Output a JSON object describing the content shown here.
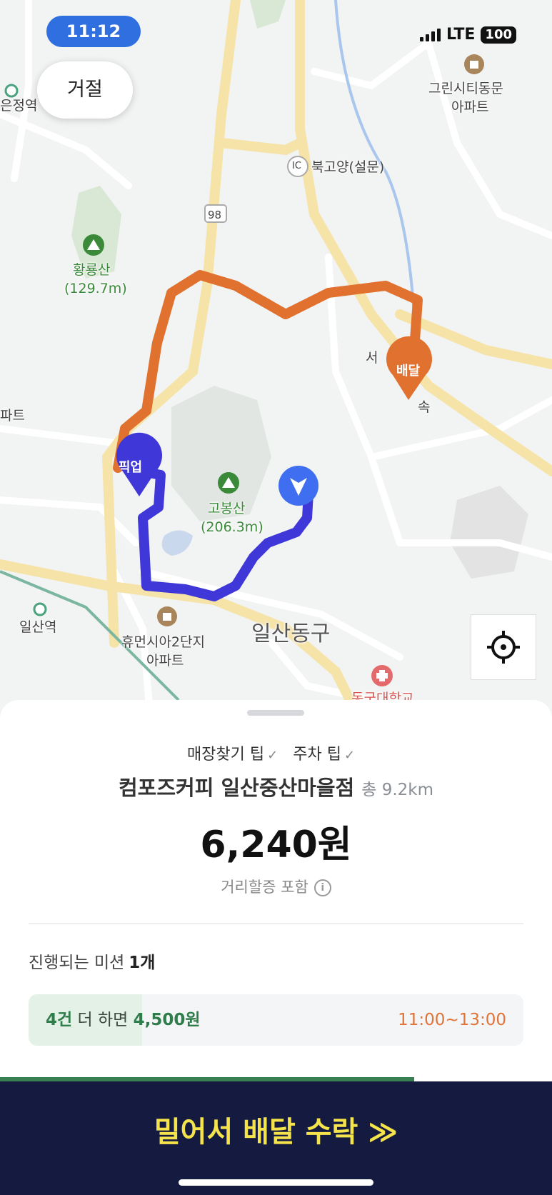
{
  "status_bar": {
    "time": "11:12",
    "network": "LTE",
    "battery": "100"
  },
  "map": {
    "reject_button": "거절",
    "markers": {
      "pickup": "픽업",
      "delivery": "배달"
    },
    "labels": {
      "station_top": "은정역",
      "green_city_1": "그린시티동문",
      "green_city_2": "아파트",
      "ic_badge": "IC",
      "bukgoyang": "북고양(설문)",
      "route_98": "98",
      "hwangyongsan_1": "황룡산",
      "hwangyongsan_2": "(129.7m)",
      "apt_left": "파트",
      "gobongsan_1": "고봉산",
      "gobongsan_2": "(206.3m)",
      "ilsan_station": "일산역",
      "humensia_1": "휴먼시아2단지",
      "humensia_2": "아파트",
      "district": "일산동구",
      "expressway_a": "서",
      "expressway_b": "속",
      "hospital": "동국대학교"
    },
    "route_colors": {
      "pickup_route": "#3f37d8",
      "delivery_route": "#e0712f"
    }
  },
  "order": {
    "tips": [
      "매장찾기 팁",
      "주차 팁"
    ],
    "store_name": "컴포즈커피 일산중산마을점",
    "total_distance": "총 9.2km",
    "price": "6,240원",
    "price_note": "거리할증 포함",
    "mission_title": "진행되는 미션",
    "mission_count": "1개",
    "mission_progress_text_count": "4건",
    "mission_progress_text_mid": "더 하면",
    "mission_reward": "4,500원",
    "mission_time": "11:00~13:00",
    "mission_progress": 0.23,
    "slide_progress": 0.75,
    "accept_label": "밀어서 배달 수락 ≫"
  }
}
